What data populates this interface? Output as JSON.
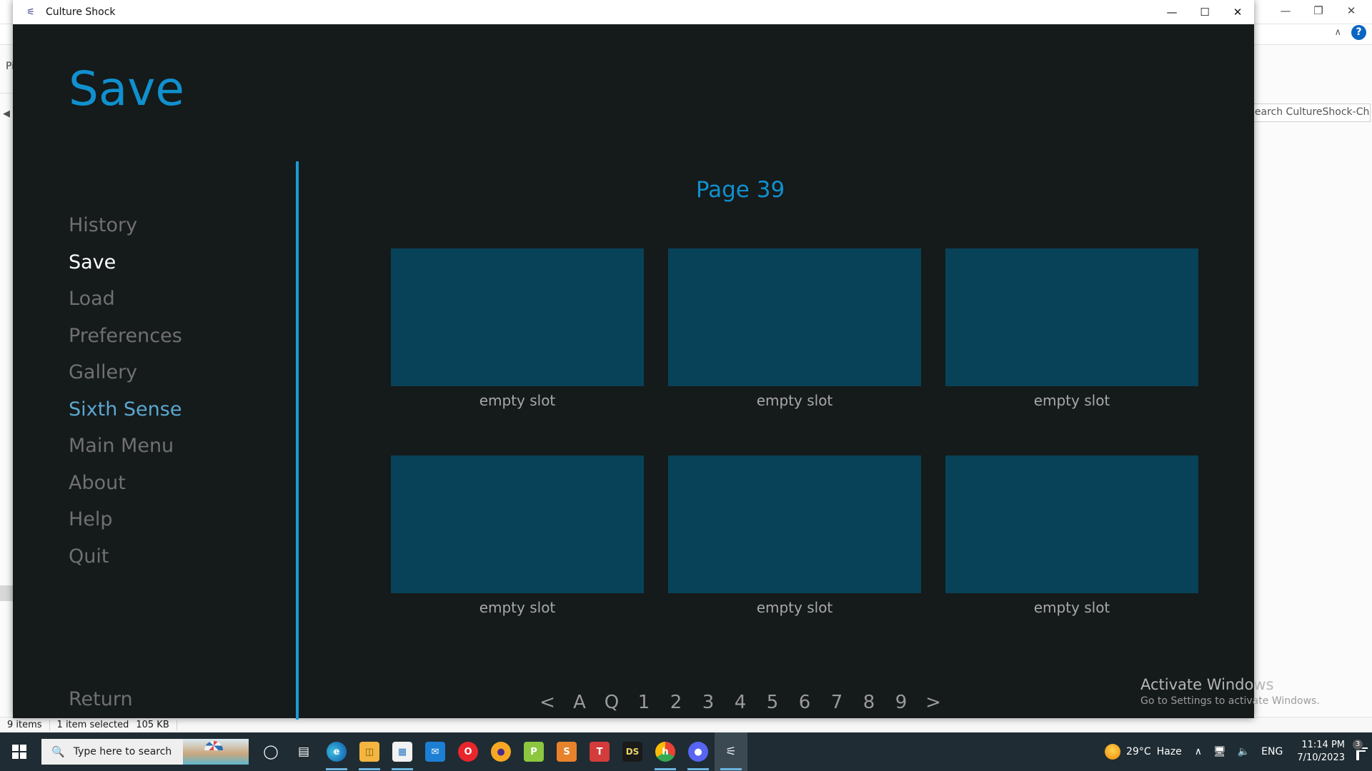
{
  "desktop": {
    "explorer": {
      "search_placeholder": "Search CultureShock-Chapt...",
      "nav_label": "Pi",
      "back_arrow": "◀",
      "minimize": "—",
      "restore": "❐",
      "close": "✕",
      "chevron_up": "∧",
      "help": "?",
      "view_details_icon": "details-view-icon",
      "view_large_icon": "large-icons-view-icon",
      "status": {
        "items": "9 items",
        "selection": "1 item selected",
        "size": "105 KB"
      }
    }
  },
  "game_window": {
    "titlebar": {
      "title": "Culture Shock",
      "app_icon": "renpy-icon",
      "minimize": "—",
      "maximize": "☐",
      "close": "✕"
    },
    "heading": "Save",
    "page_label": "Page 39",
    "return_label": "Return",
    "nav_items": [
      {
        "label": "History",
        "state": "normal"
      },
      {
        "label": "Save",
        "state": "active"
      },
      {
        "label": "Load",
        "state": "normal"
      },
      {
        "label": "Preferences",
        "state": "normal"
      },
      {
        "label": "Gallery",
        "state": "normal"
      },
      {
        "label": "Sixth Sense",
        "state": "hover"
      },
      {
        "label": "Main Menu",
        "state": "normal"
      },
      {
        "label": "About",
        "state": "normal"
      },
      {
        "label": "Help",
        "state": "normal"
      },
      {
        "label": "Quit",
        "state": "normal"
      }
    ],
    "slots": [
      {
        "label": "empty slot"
      },
      {
        "label": "empty slot"
      },
      {
        "label": "empty slot"
      },
      {
        "label": "empty slot"
      },
      {
        "label": "empty slot"
      },
      {
        "label": "empty slot"
      }
    ],
    "pager": [
      "<",
      "A",
      "Q",
      "1",
      "2",
      "3",
      "4",
      "5",
      "6",
      "7",
      "8",
      "9",
      ">"
    ],
    "colors": {
      "accent_blue": "#1090ce",
      "divider_blue": "#1a9bd7",
      "slot_fill": "#084258",
      "background": "#151a1a",
      "hover_blue": "#5ba7d1",
      "inactive_gray": "#707070"
    }
  },
  "watermark": {
    "title": "Activate Windows",
    "subtitle": "Go to Settings to activate Windows."
  },
  "taskbar": {
    "start_icon": "windows-logo-icon",
    "search_placeholder": "Type here to search",
    "search_icon": "search-icon",
    "icons": [
      {
        "name": "cortana-icon",
        "glyph": "◯",
        "color": "transparent",
        "text": "#ffffff",
        "state": "normal"
      },
      {
        "name": "task-view-icon",
        "glyph": "⌸",
        "color": "transparent",
        "text": "#ffffff",
        "state": "normal"
      },
      {
        "name": "microsoft-edge-icon",
        "glyph": "e",
        "color": "#1b74bb",
        "text": "#ffffff",
        "state": "running"
      },
      {
        "name": "file-explorer-icon",
        "glyph": "▱",
        "color": "#f3b53f",
        "text": "#7a5a12",
        "state": "running"
      },
      {
        "name": "microsoft-store-icon",
        "glyph": "⊞",
        "color": "#f2f2f2",
        "text": "#2a7ac0",
        "state": "running"
      },
      {
        "name": "mail-icon",
        "glyph": "✉",
        "color": "#1d7fd4",
        "text": "#ffffff",
        "state": "normal"
      },
      {
        "name": "opera-icon",
        "glyph": "O",
        "color": "#e8262b",
        "text": "#ffffff",
        "state": "normal"
      },
      {
        "name": "avast-icon",
        "glyph": "●",
        "color": "#f7a823",
        "text": "#4b2b8a",
        "state": "normal"
      },
      {
        "name": "powerpoint-icon",
        "glyph": "P",
        "color": "#c94f22",
        "text": "#ffffff",
        "state": "normal"
      },
      {
        "name": "excel-icon",
        "glyph": "S",
        "color": "#e8832b",
        "text": "#ffffff",
        "state": "normal"
      },
      {
        "name": "word-icon",
        "glyph": "T",
        "color": "#d43b3b",
        "text": "#ffffff",
        "state": "normal"
      },
      {
        "name": "ds-app-icon",
        "glyph": "DS",
        "color": "#1a1a1a",
        "text": "#e8d36a",
        "state": "normal"
      },
      {
        "name": "google-chrome-icon",
        "glyph": "h",
        "color": "#39a851",
        "text": "#ffffff",
        "state": "running"
      },
      {
        "name": "discord-icon",
        "glyph": "◕",
        "color": "#5865f2",
        "text": "#ffffff",
        "state": "running"
      },
      {
        "name": "renpy-icon",
        "glyph": "♫",
        "color": "transparent",
        "text": "#ffffff",
        "state": "active"
      }
    ],
    "tray": {
      "weather_icon": "sun-icon",
      "temperature": "29°C",
      "condition": "Haze",
      "chevron": "∧",
      "network_icon": "network-icon",
      "volume_icon": "volume-icon",
      "language": "ENG",
      "time": "11:14 PM",
      "date": "7/10/2023",
      "notification_icon": "notifications-icon",
      "notification_count": "3"
    }
  }
}
